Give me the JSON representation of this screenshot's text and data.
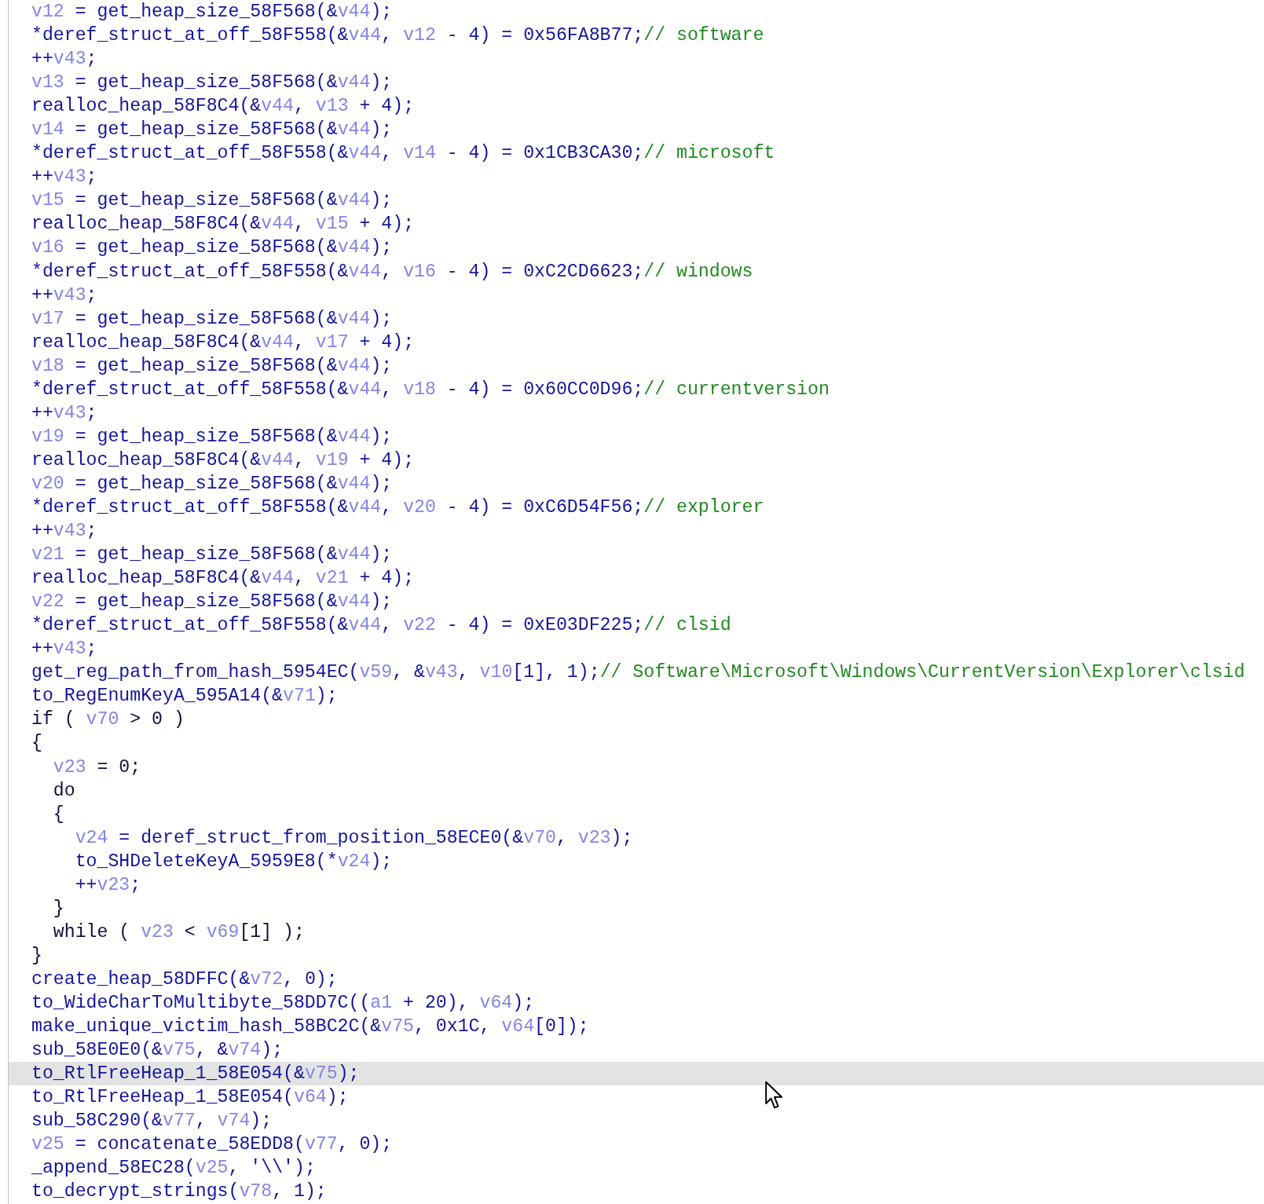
{
  "lines": [
    {
      "selected": false,
      "tokens": [
        {
          "kind": "var",
          "text": "v12"
        },
        {
          "kind": "code",
          "text": " = get_heap_size_58F568(&"
        },
        {
          "kind": "var",
          "text": "v44"
        },
        {
          "kind": "code",
          "text": ");"
        }
      ]
    },
    {
      "selected": false,
      "tokens": [
        {
          "kind": "code",
          "text": "*deref_struct_at_off_58F558(&"
        },
        {
          "kind": "var",
          "text": "v44"
        },
        {
          "kind": "code",
          "text": ", "
        },
        {
          "kind": "var",
          "text": "v12"
        },
        {
          "kind": "code",
          "text": " - 4) = 0x56FA8B77;"
        },
        {
          "kind": "comment",
          "text": "// software"
        }
      ]
    },
    {
      "selected": false,
      "tokens": [
        {
          "kind": "code",
          "text": "++"
        },
        {
          "kind": "var",
          "text": "v43"
        },
        {
          "kind": "code",
          "text": ";"
        }
      ]
    },
    {
      "selected": false,
      "tokens": [
        {
          "kind": "var",
          "text": "v13"
        },
        {
          "kind": "code",
          "text": " = get_heap_size_58F568(&"
        },
        {
          "kind": "var",
          "text": "v44"
        },
        {
          "kind": "code",
          "text": ");"
        }
      ]
    },
    {
      "selected": false,
      "tokens": [
        {
          "kind": "code",
          "text": "realloc_heap_58F8C4(&"
        },
        {
          "kind": "var",
          "text": "v44"
        },
        {
          "kind": "code",
          "text": ", "
        },
        {
          "kind": "var",
          "text": "v13"
        },
        {
          "kind": "code",
          "text": " + 4);"
        }
      ]
    },
    {
      "selected": false,
      "tokens": [
        {
          "kind": "var",
          "text": "v14"
        },
        {
          "kind": "code",
          "text": " = get_heap_size_58F568(&"
        },
        {
          "kind": "var",
          "text": "v44"
        },
        {
          "kind": "code",
          "text": ");"
        }
      ]
    },
    {
      "selected": false,
      "tokens": [
        {
          "kind": "code",
          "text": "*deref_struct_at_off_58F558(&"
        },
        {
          "kind": "var",
          "text": "v44"
        },
        {
          "kind": "code",
          "text": ", "
        },
        {
          "kind": "var",
          "text": "v14"
        },
        {
          "kind": "code",
          "text": " - 4) = 0x1CB3CA30;"
        },
        {
          "kind": "comment",
          "text": "// microsoft"
        }
      ]
    },
    {
      "selected": false,
      "tokens": [
        {
          "kind": "code",
          "text": "++"
        },
        {
          "kind": "var",
          "text": "v43"
        },
        {
          "kind": "code",
          "text": ";"
        }
      ]
    },
    {
      "selected": false,
      "tokens": [
        {
          "kind": "var",
          "text": "v15"
        },
        {
          "kind": "code",
          "text": " = get_heap_size_58F568(&"
        },
        {
          "kind": "var",
          "text": "v44"
        },
        {
          "kind": "code",
          "text": ");"
        }
      ]
    },
    {
      "selected": false,
      "tokens": [
        {
          "kind": "code",
          "text": "realloc_heap_58F8C4(&"
        },
        {
          "kind": "var",
          "text": "v44"
        },
        {
          "kind": "code",
          "text": ", "
        },
        {
          "kind": "var",
          "text": "v15"
        },
        {
          "kind": "code",
          "text": " + 4);"
        }
      ]
    },
    {
      "selected": false,
      "tokens": [
        {
          "kind": "var",
          "text": "v16"
        },
        {
          "kind": "code",
          "text": " = get_heap_size_58F568(&"
        },
        {
          "kind": "var",
          "text": "v44"
        },
        {
          "kind": "code",
          "text": ");"
        }
      ]
    },
    {
      "selected": false,
      "tokens": [
        {
          "kind": "code",
          "text": "*deref_struct_at_off_58F558(&"
        },
        {
          "kind": "var",
          "text": "v44"
        },
        {
          "kind": "code",
          "text": ", "
        },
        {
          "kind": "var",
          "text": "v16"
        },
        {
          "kind": "code",
          "text": " - 4) = 0xC2CD6623;"
        },
        {
          "kind": "comment",
          "text": "// windows"
        }
      ]
    },
    {
      "selected": false,
      "tokens": [
        {
          "kind": "code",
          "text": "++"
        },
        {
          "kind": "var",
          "text": "v43"
        },
        {
          "kind": "code",
          "text": ";"
        }
      ]
    },
    {
      "selected": false,
      "tokens": [
        {
          "kind": "var",
          "text": "v17"
        },
        {
          "kind": "code",
          "text": " = get_heap_size_58F568(&"
        },
        {
          "kind": "var",
          "text": "v44"
        },
        {
          "kind": "code",
          "text": ");"
        }
      ]
    },
    {
      "selected": false,
      "tokens": [
        {
          "kind": "code",
          "text": "realloc_heap_58F8C4(&"
        },
        {
          "kind": "var",
          "text": "v44"
        },
        {
          "kind": "code",
          "text": ", "
        },
        {
          "kind": "var",
          "text": "v17"
        },
        {
          "kind": "code",
          "text": " + 4);"
        }
      ]
    },
    {
      "selected": false,
      "tokens": [
        {
          "kind": "var",
          "text": "v18"
        },
        {
          "kind": "code",
          "text": " = get_heap_size_58F568(&"
        },
        {
          "kind": "var",
          "text": "v44"
        },
        {
          "kind": "code",
          "text": ");"
        }
      ]
    },
    {
      "selected": false,
      "tokens": [
        {
          "kind": "code",
          "text": "*deref_struct_at_off_58F558(&"
        },
        {
          "kind": "var",
          "text": "v44"
        },
        {
          "kind": "code",
          "text": ", "
        },
        {
          "kind": "var",
          "text": "v18"
        },
        {
          "kind": "code",
          "text": " - 4) = 0x60CC0D96;"
        },
        {
          "kind": "comment",
          "text": "// currentversion"
        }
      ]
    },
    {
      "selected": false,
      "tokens": [
        {
          "kind": "code",
          "text": "++"
        },
        {
          "kind": "var",
          "text": "v43"
        },
        {
          "kind": "code",
          "text": ";"
        }
      ]
    },
    {
      "selected": false,
      "tokens": [
        {
          "kind": "var",
          "text": "v19"
        },
        {
          "kind": "code",
          "text": " = get_heap_size_58F568(&"
        },
        {
          "kind": "var",
          "text": "v44"
        },
        {
          "kind": "code",
          "text": ");"
        }
      ]
    },
    {
      "selected": false,
      "tokens": [
        {
          "kind": "code",
          "text": "realloc_heap_58F8C4(&"
        },
        {
          "kind": "var",
          "text": "v44"
        },
        {
          "kind": "code",
          "text": ", "
        },
        {
          "kind": "var",
          "text": "v19"
        },
        {
          "kind": "code",
          "text": " + 4);"
        }
      ]
    },
    {
      "selected": false,
      "tokens": [
        {
          "kind": "var",
          "text": "v20"
        },
        {
          "kind": "code",
          "text": " = get_heap_size_58F568(&"
        },
        {
          "kind": "var",
          "text": "v44"
        },
        {
          "kind": "code",
          "text": ");"
        }
      ]
    },
    {
      "selected": false,
      "tokens": [
        {
          "kind": "code",
          "text": "*deref_struct_at_off_58F558(&"
        },
        {
          "kind": "var",
          "text": "v44"
        },
        {
          "kind": "code",
          "text": ", "
        },
        {
          "kind": "var",
          "text": "v20"
        },
        {
          "kind": "code",
          "text": " - 4) = 0xC6D54F56;"
        },
        {
          "kind": "comment",
          "text": "// explorer"
        }
      ]
    },
    {
      "selected": false,
      "tokens": [
        {
          "kind": "code",
          "text": "++"
        },
        {
          "kind": "var",
          "text": "v43"
        },
        {
          "kind": "code",
          "text": ";"
        }
      ]
    },
    {
      "selected": false,
      "tokens": [
        {
          "kind": "var",
          "text": "v21"
        },
        {
          "kind": "code",
          "text": " = get_heap_size_58F568(&"
        },
        {
          "kind": "var",
          "text": "v44"
        },
        {
          "kind": "code",
          "text": ");"
        }
      ]
    },
    {
      "selected": false,
      "tokens": [
        {
          "kind": "code",
          "text": "realloc_heap_58F8C4(&"
        },
        {
          "kind": "var",
          "text": "v44"
        },
        {
          "kind": "code",
          "text": ", "
        },
        {
          "kind": "var",
          "text": "v21"
        },
        {
          "kind": "code",
          "text": " + 4);"
        }
      ]
    },
    {
      "selected": false,
      "tokens": [
        {
          "kind": "var",
          "text": "v22"
        },
        {
          "kind": "code",
          "text": " = get_heap_size_58F568(&"
        },
        {
          "kind": "var",
          "text": "v44"
        },
        {
          "kind": "code",
          "text": ");"
        }
      ]
    },
    {
      "selected": false,
      "tokens": [
        {
          "kind": "code",
          "text": "*deref_struct_at_off_58F558(&"
        },
        {
          "kind": "var",
          "text": "v44"
        },
        {
          "kind": "code",
          "text": ", "
        },
        {
          "kind": "var",
          "text": "v22"
        },
        {
          "kind": "code",
          "text": " - 4) = 0xE03DF225;"
        },
        {
          "kind": "comment",
          "text": "// clsid"
        }
      ]
    },
    {
      "selected": false,
      "tokens": [
        {
          "kind": "code",
          "text": "++"
        },
        {
          "kind": "var",
          "text": "v43"
        },
        {
          "kind": "code",
          "text": ";"
        }
      ]
    },
    {
      "selected": false,
      "tokens": [
        {
          "kind": "code",
          "text": "get_reg_path_from_hash_5954EC("
        },
        {
          "kind": "var",
          "text": "v59"
        },
        {
          "kind": "code",
          "text": ", &"
        },
        {
          "kind": "var",
          "text": "v43"
        },
        {
          "kind": "code",
          "text": ", "
        },
        {
          "kind": "var",
          "text": "v10"
        },
        {
          "kind": "code",
          "text": "[1], 1);"
        },
        {
          "kind": "comment",
          "text": "// Software\\Microsoft\\Windows\\CurrentVersion\\Explorer\\clsid"
        }
      ]
    },
    {
      "selected": false,
      "tokens": [
        {
          "kind": "code",
          "text": "to_RegEnumKeyA_595A14(&"
        },
        {
          "kind": "var",
          "text": "v71"
        },
        {
          "kind": "code",
          "text": ");"
        }
      ]
    },
    {
      "selected": false,
      "tokens": [
        {
          "kind": "keyword",
          "text": "if ( "
        },
        {
          "kind": "var",
          "text": "v70"
        },
        {
          "kind": "keyword",
          "text": " > 0 )"
        }
      ]
    },
    {
      "selected": false,
      "tokens": [
        {
          "kind": "keyword",
          "text": "{"
        }
      ]
    },
    {
      "selected": false,
      "tokens": [
        {
          "kind": "var",
          "text": "  v23"
        },
        {
          "kind": "keyword",
          "text": " = 0;"
        }
      ]
    },
    {
      "selected": false,
      "tokens": [
        {
          "kind": "keyword",
          "text": "  do"
        }
      ]
    },
    {
      "selected": false,
      "tokens": [
        {
          "kind": "keyword",
          "text": "  {"
        }
      ]
    },
    {
      "selected": false,
      "tokens": [
        {
          "kind": "var",
          "text": "    v24"
        },
        {
          "kind": "code",
          "text": " = deref_struct_from_position_58ECE0(&"
        },
        {
          "kind": "var",
          "text": "v70"
        },
        {
          "kind": "code",
          "text": ", "
        },
        {
          "kind": "var",
          "text": "v23"
        },
        {
          "kind": "code",
          "text": ");"
        }
      ]
    },
    {
      "selected": false,
      "tokens": [
        {
          "kind": "code",
          "text": "    to_SHDeleteKeyA_5959E8(*"
        },
        {
          "kind": "var",
          "text": "v24"
        },
        {
          "kind": "code",
          "text": ");"
        }
      ]
    },
    {
      "selected": false,
      "tokens": [
        {
          "kind": "code",
          "text": "    ++"
        },
        {
          "kind": "var",
          "text": "v23"
        },
        {
          "kind": "code",
          "text": ";"
        }
      ]
    },
    {
      "selected": false,
      "tokens": [
        {
          "kind": "keyword",
          "text": "  }"
        }
      ]
    },
    {
      "selected": false,
      "tokens": [
        {
          "kind": "keyword",
          "text": "  while ( "
        },
        {
          "kind": "var",
          "text": "v23"
        },
        {
          "kind": "keyword",
          "text": " < "
        },
        {
          "kind": "var",
          "text": "v69"
        },
        {
          "kind": "keyword",
          "text": "[1] );"
        }
      ]
    },
    {
      "selected": false,
      "tokens": [
        {
          "kind": "keyword",
          "text": "}"
        }
      ]
    },
    {
      "selected": false,
      "tokens": [
        {
          "kind": "code",
          "text": "create_heap_58DFFC(&"
        },
        {
          "kind": "var",
          "text": "v72"
        },
        {
          "kind": "code",
          "text": ", 0);"
        }
      ]
    },
    {
      "selected": false,
      "tokens": [
        {
          "kind": "code",
          "text": "to_WideCharToMultibyte_58DD7C(("
        },
        {
          "kind": "var",
          "text": "a1"
        },
        {
          "kind": "code",
          "text": " + 20), "
        },
        {
          "kind": "var",
          "text": "v64"
        },
        {
          "kind": "code",
          "text": ");"
        }
      ]
    },
    {
      "selected": false,
      "tokens": [
        {
          "kind": "code",
          "text": "make_unique_victim_hash_58BC2C(&"
        },
        {
          "kind": "var",
          "text": "v75"
        },
        {
          "kind": "code",
          "text": ", 0x1C, "
        },
        {
          "kind": "var",
          "text": "v64"
        },
        {
          "kind": "code",
          "text": "[0]);"
        }
      ]
    },
    {
      "selected": false,
      "tokens": [
        {
          "kind": "code",
          "text": "sub_58E0E0(&"
        },
        {
          "kind": "var",
          "text": "v75"
        },
        {
          "kind": "code",
          "text": ", &"
        },
        {
          "kind": "var",
          "text": "v74"
        },
        {
          "kind": "code",
          "text": ");"
        }
      ]
    },
    {
      "selected": true,
      "tokens": [
        {
          "kind": "code",
          "text": "to_RtlFreeHeap_1_58E054(&"
        },
        {
          "kind": "var",
          "text": "v75"
        },
        {
          "kind": "code",
          "text": ");"
        }
      ]
    },
    {
      "selected": false,
      "tokens": [
        {
          "kind": "code",
          "text": "to_RtlFreeHeap_1_58E054("
        },
        {
          "kind": "var",
          "text": "v64"
        },
        {
          "kind": "code",
          "text": ");"
        }
      ]
    },
    {
      "selected": false,
      "tokens": [
        {
          "kind": "code",
          "text": "sub_58C290(&"
        },
        {
          "kind": "var",
          "text": "v77"
        },
        {
          "kind": "code",
          "text": ", "
        },
        {
          "kind": "var",
          "text": "v74"
        },
        {
          "kind": "code",
          "text": ");"
        }
      ]
    },
    {
      "selected": false,
      "tokens": [
        {
          "kind": "var",
          "text": "v25"
        },
        {
          "kind": "code",
          "text": " = concatenate_58EDD8("
        },
        {
          "kind": "var",
          "text": "v77"
        },
        {
          "kind": "code",
          "text": ", 0);"
        }
      ]
    },
    {
      "selected": false,
      "tokens": [
        {
          "kind": "code",
          "text": "_append_58EC28("
        },
        {
          "kind": "var",
          "text": "v25"
        },
        {
          "kind": "code",
          "text": ", '\\\\');"
        }
      ]
    },
    {
      "selected": false,
      "tokens": [
        {
          "kind": "code",
          "text": "to_decrypt_strings("
        },
        {
          "kind": "var",
          "text": "v78"
        },
        {
          "kind": "code",
          "text": ", 1);"
        }
      ]
    }
  ]
}
